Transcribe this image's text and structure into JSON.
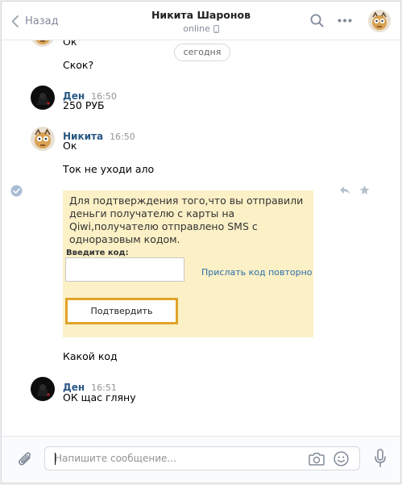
{
  "topbar": {
    "back_label": "Назад",
    "peer_name": "Никита Шаронов",
    "peer_status": "online"
  },
  "chat": {
    "date_divider": "сегодня",
    "messages": [
      {
        "sender": "",
        "time": "",
        "text": "Ок"
      },
      {
        "sender": "",
        "time": "",
        "text": "Скок?"
      },
      {
        "sender": "Ден",
        "time": "16:50",
        "text": "250 РУБ"
      },
      {
        "sender": "Никита",
        "time": "16:50",
        "text": "Ок"
      },
      {
        "sender": "",
        "time": "",
        "text": "Ток не уходи ало"
      },
      {
        "sender": "",
        "time": "",
        "text": "Какой код"
      },
      {
        "sender": "Ден",
        "time": "16:51",
        "text": "ОК щас гляну"
      }
    ],
    "qiwi_card": {
      "text": "Для подтверждения того,что вы отправили деньги получателю с карты на Qiwi,получателю отправлено SMS с одноразовым кодом.",
      "code_label": "Введите код:",
      "code_value": "",
      "resend_link": "Прислать код повторно",
      "confirm_button": "Подтвердить"
    }
  },
  "composer": {
    "placeholder": "Напишите сообщение..."
  },
  "colors": {
    "link": "#2a5885",
    "muted": "#828a99",
    "accent_check": "#5181b8",
    "card_bg": "#fcf0c6",
    "card_button_border": "#e0a32b"
  },
  "icons": [
    "chevron-left-icon",
    "search-icon",
    "more-icon",
    "phone-icon",
    "read-check-icon",
    "reply-icon",
    "star-icon",
    "attach-icon",
    "camera-icon",
    "emoji-icon",
    "microphone-icon"
  ]
}
